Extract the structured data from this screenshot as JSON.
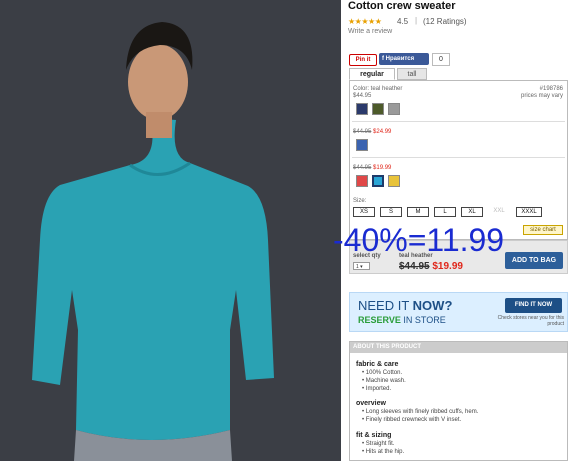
{
  "product": {
    "title": "Cotton crew sweater",
    "stars": "★★★★★",
    "rating": "4.5",
    "rating_sep": "|",
    "ratings_count": "(12 Ratings)",
    "write_review": "Write a review"
  },
  "social": {
    "pin_label": "Pin it",
    "fb_label": "Нравится",
    "fb_count": "0"
  },
  "tabs": [
    "regular",
    "tall"
  ],
  "colors_block": {
    "color_label": "Color: teal heather",
    "style_no": "#198786",
    "prices_vary": "prices may vary",
    "price_1": "$44.95",
    "group2_old": "$44.95",
    "group2_new": "$24.99",
    "group3_old": "$44.95",
    "group3_new": "$19.99",
    "swatches_1": [
      "#2b3a6b",
      "#4d5a2a",
      "#9a9a9a"
    ],
    "swatches_2": [
      "#3b63b0"
    ],
    "swatches_3": [
      "#e04848",
      "#2aa6d6",
      "#e8c33a"
    ]
  },
  "sizes": {
    "label": "Size:",
    "options": [
      "XS",
      "S",
      "M",
      "L",
      "XL",
      "XXL",
      "XXXL"
    ],
    "size_chart": "size chart"
  },
  "add_to_bag": {
    "select_qty": "select qty",
    "qty_value": "1 ▾",
    "color_name": "teal heather",
    "old_price": "$44.95",
    "new_price": "$19.99",
    "button": "ADD TO BAG"
  },
  "overlay_text": "-40%=11.99",
  "find_it_now": {
    "need": "NEED IT ",
    "now": "NOW?",
    "reserve": "RESERVE",
    "in_store": " IN STORE",
    "button": "FIND IT NOW",
    "check_stores": "Check stores near you for this product"
  },
  "about": {
    "header": "ABOUT THIS PRODUCT",
    "fabric_h": "fabric & care",
    "fabric": [
      "100% Cotton.",
      "Machine wash.",
      "Imported."
    ],
    "overview_h": "overview",
    "overview": [
      "Long sleeves with finely ribbed cuffs, hem.",
      "Finely ribbed crewneck with V inset."
    ],
    "fit_h": "fit & sizing",
    "fit": [
      "Straight fit.",
      "Hits at the hip."
    ]
  }
}
